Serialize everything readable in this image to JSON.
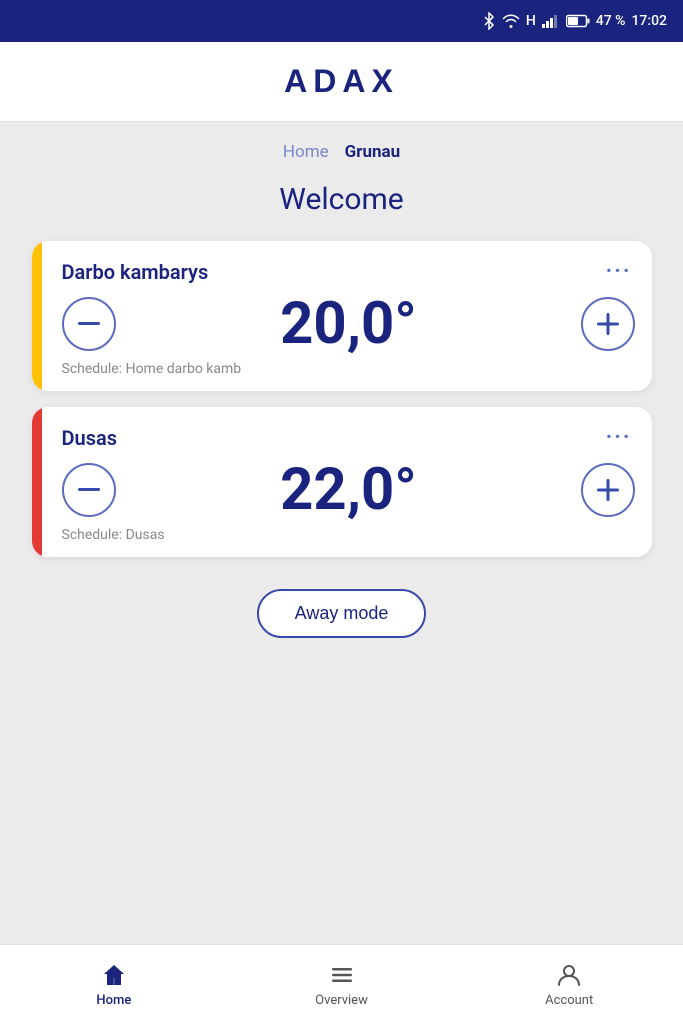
{
  "statusBar": {
    "battery": "47 %",
    "time": "17:02"
  },
  "header": {
    "logo": "ADAX"
  },
  "breadcrumb": {
    "home": "Home",
    "current": "Grunau"
  },
  "welcome": {
    "title": "Welcome"
  },
  "devices": [
    {
      "id": "darbo-kambarys",
      "name": "Darbo kambarys",
      "temperature": "20,0°",
      "schedule": "Schedule: Home darbo kamb",
      "accentColor": "yellow"
    },
    {
      "id": "dusas",
      "name": "Dusas",
      "temperature": "22,0°",
      "schedule": "Schedule: Dusas",
      "accentColor": "orange"
    }
  ],
  "awayModeBtn": "Away mode",
  "bottomNav": {
    "items": [
      {
        "id": "home",
        "label": "Home",
        "active": true
      },
      {
        "id": "overview",
        "label": "Overview",
        "active": false
      },
      {
        "id": "account",
        "label": "Account",
        "active": false
      }
    ]
  }
}
